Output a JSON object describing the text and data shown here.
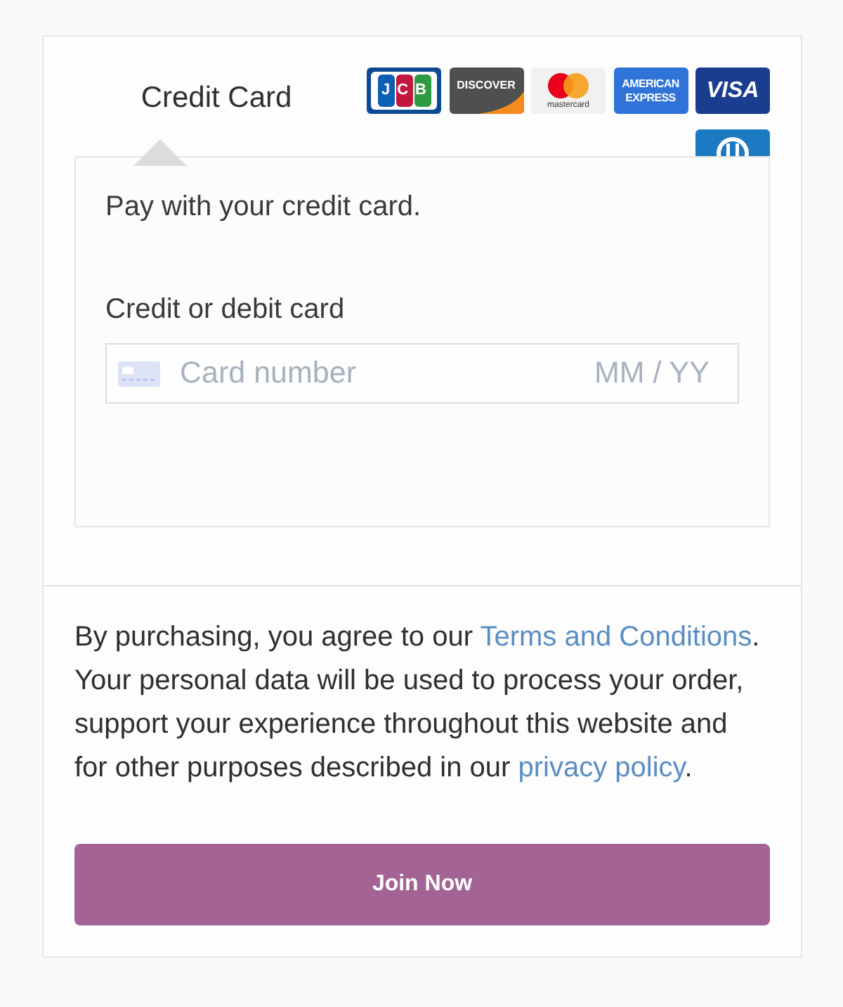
{
  "payment_tabs": [
    {
      "label": "Credit Card",
      "selected": true
    }
  ],
  "card_logos": [
    {
      "kind": "tiles",
      "text": "JCB"
    },
    {
      "kind": "swoosh",
      "text": "DISCOVER"
    },
    {
      "kind": "circles",
      "text": "mastercard"
    },
    {
      "kind": "boxed",
      "text": "AMERICAN EXPRESS"
    },
    {
      "kind": "italic",
      "text": "VISA"
    },
    {
      "kind": "ring"
    }
  ],
  "panel": {
    "intro": "Pay with your credit card.",
    "field_label": "Credit or debit card",
    "card_number": {
      "placeholder": "Card number"
    },
    "expiry": {
      "placeholder": "MM / YY"
    }
  },
  "terms": [
    {
      "kind": "text",
      "text": "By purchasing, you agree to our "
    },
    {
      "kind": "link",
      "text": "Terms and Conditions"
    },
    {
      "kind": "text",
      "text": ". Your personal data will be used to process your order, support your experience throughout this website and for other purposes described in our "
    },
    {
      "kind": "link",
      "text": "privacy policy"
    },
    {
      "kind": "text",
      "text": "."
    }
  ],
  "submit_button": "Join Now"
}
